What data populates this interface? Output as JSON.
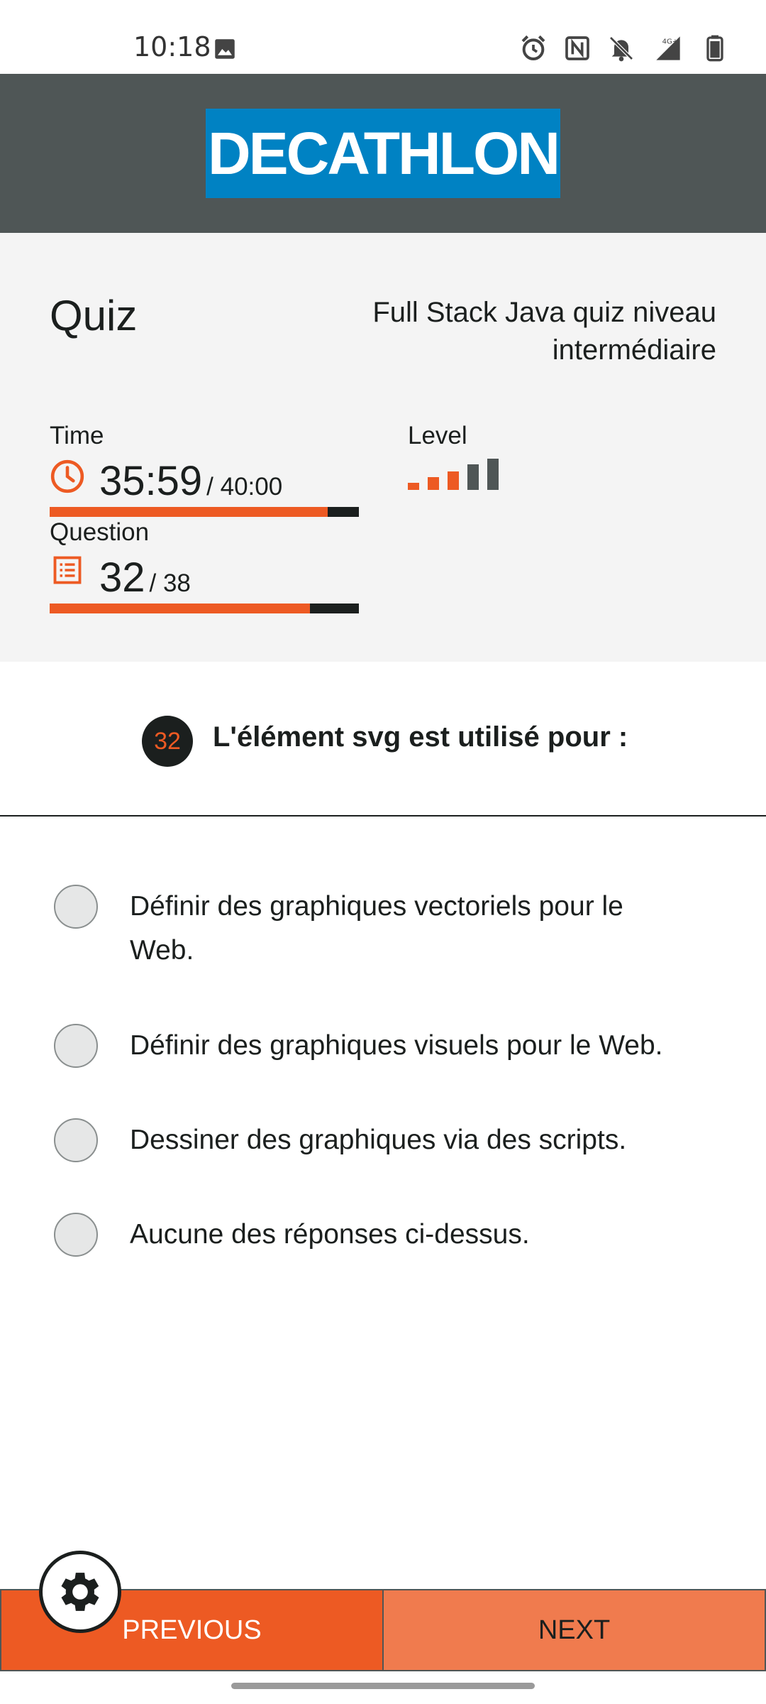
{
  "status_bar": {
    "time": "10:18",
    "network": "4G+",
    "icons": [
      "image-icon",
      "alarm-icon",
      "nfc-icon",
      "bell-off-icon",
      "signal-icon",
      "battery-icon"
    ]
  },
  "header": {
    "logo_text": "DECATHLON",
    "logo_bg": "#0082c3",
    "header_bg": "#4f5656"
  },
  "quiz": {
    "title": "Quiz",
    "name_line1": "Full Stack Java quiz niveau",
    "name_line2": "intermédiaire"
  },
  "time": {
    "label": "Time",
    "value": "35:59",
    "total": "/ 40:00",
    "progress_fraction": 0.9
  },
  "level": {
    "label": "Level",
    "levels_active": 3,
    "levels_total": 5
  },
  "question_stats": {
    "label": "Question",
    "value": "32",
    "total": "/ 38",
    "progress_fraction": 0.842
  },
  "question": {
    "number": "32",
    "text": "L'élément svg est utilisé pour :"
  },
  "answers": [
    {
      "line1": "Définir des graphiques vectoriels pour le",
      "line2": "Web.",
      "selected": false
    },
    {
      "line1": "Définir des graphiques visuels pour le Web.",
      "line2": "",
      "selected": false
    },
    {
      "line1": "Dessiner des graphiques via des scripts.",
      "line2": "",
      "selected": false
    },
    {
      "line1": "Aucune des réponses ci-dessus.",
      "line2": "",
      "selected": false
    }
  ],
  "buttons": {
    "previous": "PREVIOUS",
    "next": "NEXT"
  },
  "colors": {
    "accent": "#ed5a23",
    "accent_light": "#f07b4e",
    "dark": "#1b1f1e",
    "panel_bg": "#f4f4f4",
    "inactive_level": "#4f5656"
  }
}
